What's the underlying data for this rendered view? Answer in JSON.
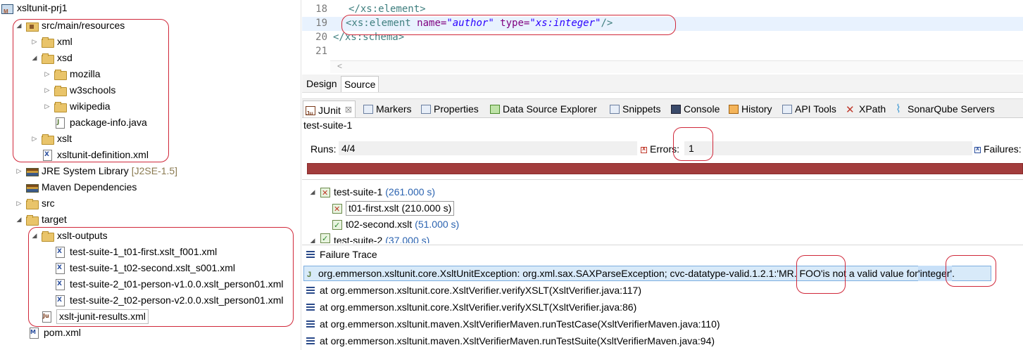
{
  "tree": {
    "project": "xsltunit-prj1",
    "src_main_resources": "src/main/resources",
    "xml": "xml",
    "xsd": "xsd",
    "mozilla": "mozilla",
    "w3schools": "w3schools",
    "wikipedia": "wikipedia",
    "package_info": "package-info.java",
    "xslt": "xslt",
    "xsltunit_definition": "xsltunit-definition.xml",
    "jre": "JRE System Library",
    "jre_version": "[J2SE-1.5]",
    "maven_deps": "Maven Dependencies",
    "src": "src",
    "target": "target",
    "xslt_outputs": "xslt-outputs",
    "out1": "test-suite-1_t01-first.xslt_f001.xml",
    "out2": "test-suite-1_t02-second.xslt_s001.xml",
    "out3": "test-suite-2_t01-person-v1.0.0.xslt_person01.xml",
    "out4": "test-suite-2_t02-person-v2.0.0.xslt_person01.xml",
    "junit_results": "xslt-junit-results.xml",
    "pom": "pom.xml"
  },
  "editor": {
    "lines": [
      {
        "num": "18",
        "text": "</xs:element>"
      },
      {
        "num": "19",
        "open": "<xs:element ",
        "attr1": "name=",
        "val1": "\"author\"",
        "attr2": " type=",
        "val2": "\"xs:integer\"",
        "close": "/>"
      },
      {
        "num": "20",
        "text": "</xs:schema>"
      },
      {
        "num": "21",
        "text": ""
      }
    ],
    "scroll_arrow": "<"
  },
  "design_tabs": {
    "design": "Design",
    "source": "Source"
  },
  "views": {
    "junit": "JUnit",
    "junit_close": "☒",
    "markers": "Markers",
    "properties": "Properties",
    "data_source": "Data Source Explorer",
    "snippets": "Snippets",
    "console": "Console",
    "history": "History",
    "api_tools": "API Tools",
    "xpath": "XPath",
    "sonarqube": "SonarQube Servers"
  },
  "junit": {
    "suite_title": "test-suite-1",
    "runs_label": "Runs:",
    "runs_value": "4/4",
    "errors_label": "Errors:",
    "errors_value": "1",
    "failures_label": "Failures:",
    "progress_fraction": 1.0,
    "progress_color": "#a23c3c",
    "results": [
      {
        "name": "test-suite-1",
        "time": "(261.000 s)"
      },
      {
        "name": "t01-first.xslt",
        "time": "(210.000 s)"
      },
      {
        "name": "t02-second.xslt",
        "time": "(51.000 s)"
      },
      {
        "name": "test-suite-2",
        "time": "(37.000 s)"
      }
    ],
    "failure_trace_label": "Failure Trace",
    "trace_first_prefix": "org.emmerson.xsltunit.core.XsltUnitException: org.xml.sax.SAXParseException; cvc-datatype-valid.1.2.1: ",
    "trace_first_value": "'MR. FOO'",
    "trace_first_middle": " is not a valid value for ",
    "trace_first_type": "'integer'",
    "trace_first_end": ".",
    "trace_lines": [
      "at org.emmerson.xsltunit.core.XsltVerifier.verifyXSLT(XsltVerifier.java:117)",
      "at org.emmerson.xsltunit.core.XsltVerifier.verifyXSLT(XsltVerifier.java:86)",
      "at org.emmerson.xsltunit.maven.XsltVerifierMaven.runTestCase(XsltVerifierMaven.java:110)",
      "at org.emmerson.xsltunit.maven.XsltVerifierMaven.runTestSuite(XsltVerifierMaven.java:94)"
    ]
  },
  "colors": {
    "annotation_red": "#d0283a",
    "error_bar": "#a23c3c",
    "time_blue": "#2b63b0"
  }
}
